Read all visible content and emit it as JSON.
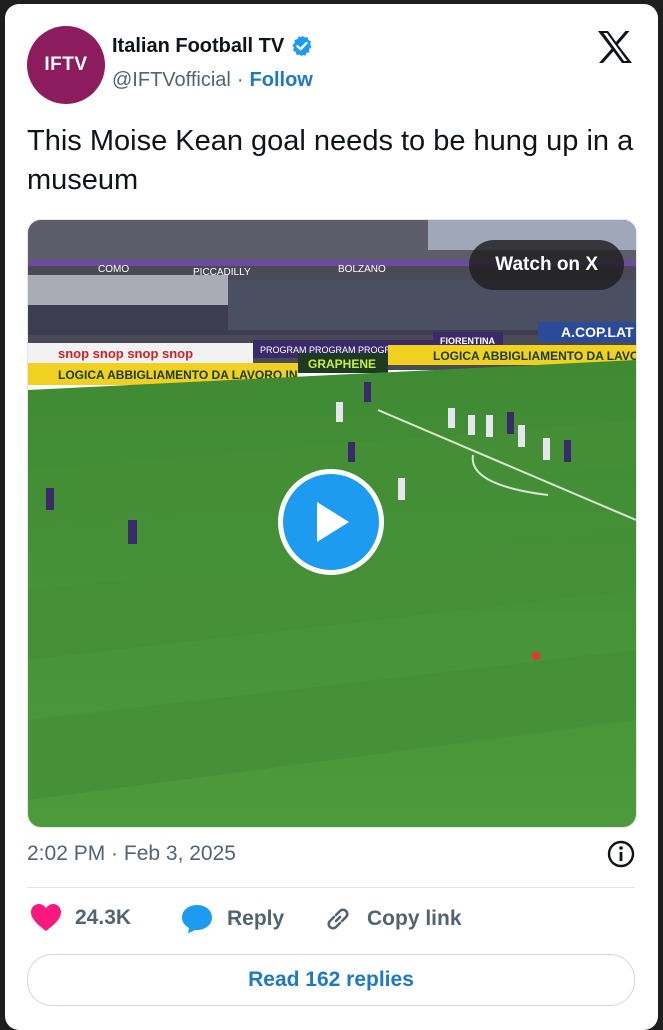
{
  "author": {
    "avatar_text": "IFTV",
    "display_name": "Italian Football TV",
    "handle": "@IFTVofficial",
    "separator": "·",
    "follow_label": "Follow",
    "verified_color": "#1d9bf0"
  },
  "tweet": {
    "text": "This Moise Kean goal needs to be hung up in a museum"
  },
  "media": {
    "watch_label": "Watch on X",
    "boards": {
      "b1": "snop  snop  snop  snop",
      "b2": "PROGRAM  PROGRAM  PROGRAM",
      "b3": "FIORENTINA",
      "b4": "A.COP.LAT",
      "b5": "LOGICA  ABBIGLIAMENTO DA LAVORO IN",
      "b6": "GRAPHENE",
      "b7": "LOGICA  ABBIGLIAMENTO DA LAVORO",
      "b8": "PICCADILLY",
      "b9": "BOLZANO",
      "b10": "COMO"
    }
  },
  "meta": {
    "timestamp": "2:02 PM · Feb 3, 2025"
  },
  "actions": {
    "likes": "24.3K",
    "reply_label": "Reply",
    "copy_label": "Copy link",
    "read_replies_label": "Read 162 replies"
  },
  "colors": {
    "accent": "#1d79c4",
    "like": "#f91880",
    "avatar_bg": "#8c1c5d"
  },
  "icons": [
    "verified-badge-icon",
    "x-logo-icon",
    "play-icon",
    "info-icon",
    "heart-icon",
    "reply-bubble-icon",
    "link-icon"
  ]
}
